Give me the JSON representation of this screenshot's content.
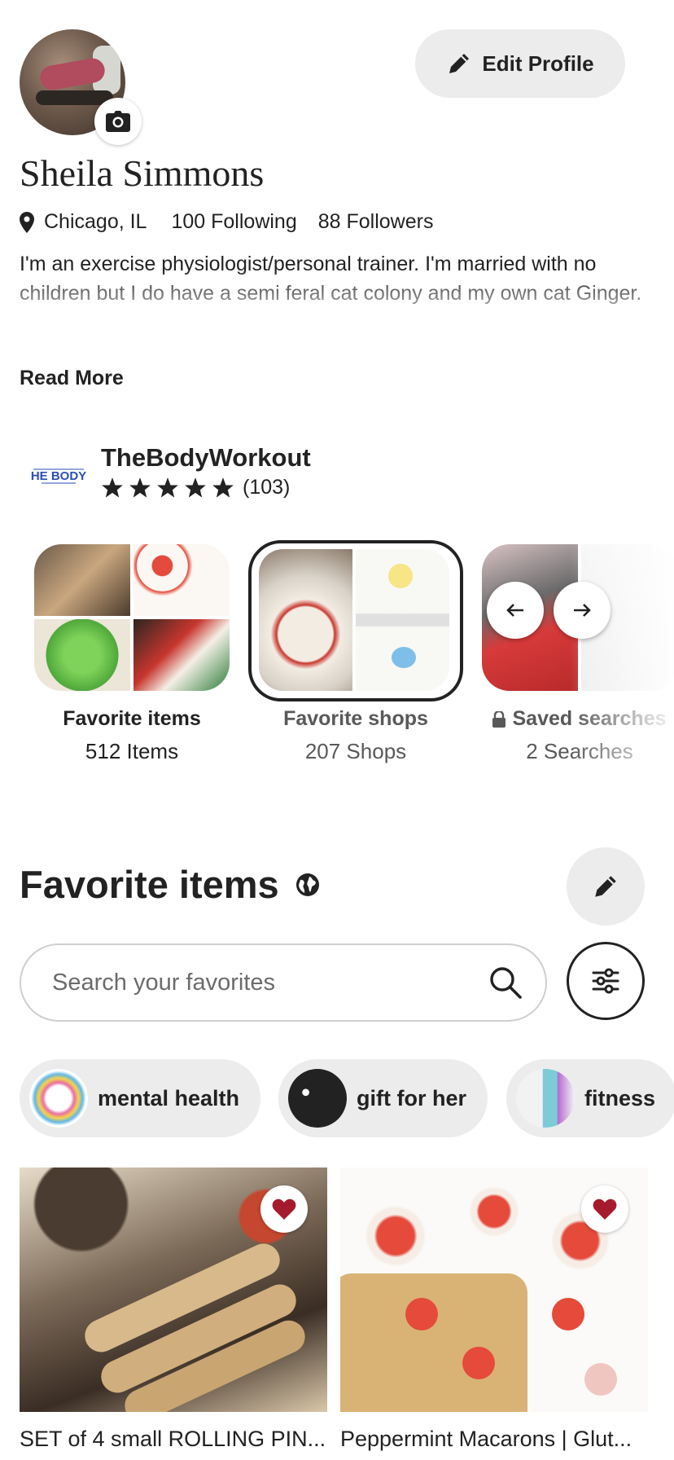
{
  "profile": {
    "name": "Sheila Simmons",
    "location": "Chicago, IL",
    "following": "100 Following",
    "followers": "88 Followers",
    "bio": "I'm an exercise physiologist/personal trainer. I'm married with no children but I do have a semi feral cat colony and my own cat Ginger.",
    "read_more": "Read More",
    "edit_profile_label": "Edit Profile"
  },
  "shop": {
    "logo_text": "HE BODY",
    "name": "TheBodyWorkout",
    "stars": 5,
    "review_count": "(103)"
  },
  "collections": [
    {
      "label": "Favorite items",
      "count": "512 Items",
      "locked": false
    },
    {
      "label": "Favorite shops",
      "count": "207 Shops",
      "locked": false
    },
    {
      "label": "Saved searches",
      "count": "2 Searches",
      "locked": true
    }
  ],
  "favorites": {
    "title": "Favorite items",
    "search_placeholder": "Search your favorites"
  },
  "chips": [
    {
      "label": "mental health"
    },
    {
      "label": "gift for her"
    },
    {
      "label": "fitness"
    }
  ],
  "items": [
    {
      "title": "SET of 4 small ROLLING PIN...",
      "favorited": true
    },
    {
      "title": "Peppermint Macarons | Glut...",
      "favorited": true
    }
  ],
  "colors": {
    "text": "#222222",
    "muted": "#595959",
    "chip_bg": "#ececec",
    "heart": "#a61a2e"
  }
}
